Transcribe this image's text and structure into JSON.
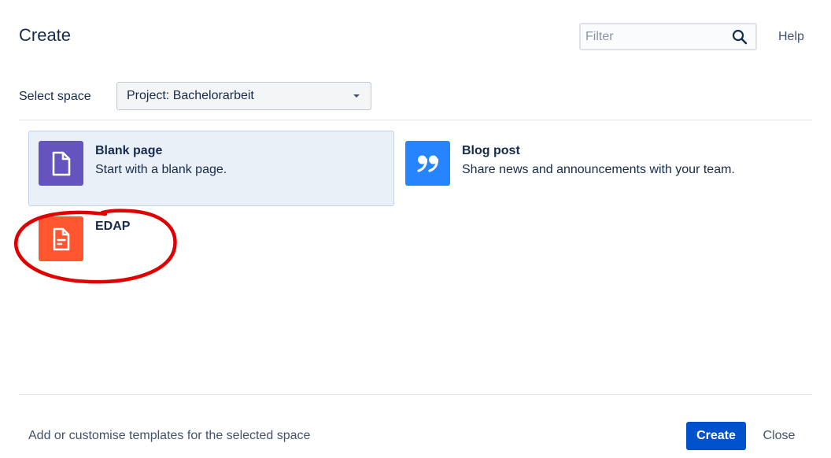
{
  "header": {
    "title": "Create",
    "filter_placeholder": "Filter",
    "help_label": "Help"
  },
  "space_selector": {
    "label": "Select space",
    "selected": "Project: Bachelorarbeit"
  },
  "templates": [
    {
      "name": "Blank page",
      "description": "Start with a blank page.",
      "icon": "blank-page-icon",
      "color": "#6554c0",
      "selected": true
    },
    {
      "name": "Blog post",
      "description": "Share news and announcements with your team.",
      "icon": "quote-icon",
      "color": "#2684ff",
      "selected": false
    },
    {
      "name": "EDAP",
      "description": "",
      "icon": "document-icon",
      "color": "#ff5630",
      "selected": false
    }
  ],
  "annotation": {
    "shape": "hand-drawn-circle",
    "color": "#e00000",
    "target": "EDAP"
  },
  "footer": {
    "customise_link": "Add or customise templates for the selected space",
    "create_label": "Create",
    "close_label": "Close"
  },
  "colors": {
    "primary": "#0052cc",
    "selected_card_bg": "#eaf0f8",
    "text": "#172b4d",
    "subtle_text": "#42526e"
  }
}
